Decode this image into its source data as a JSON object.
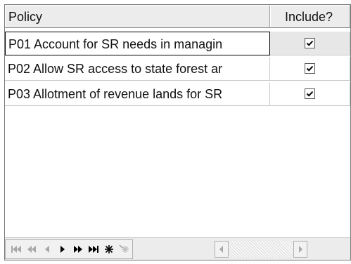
{
  "grid": {
    "columns": {
      "policy": "Policy",
      "include": "Include?"
    },
    "rows": [
      {
        "policy": "P01 Account for SR needs in managin",
        "include": true
      },
      {
        "policy": "P02 Allow SR access to state forest ar",
        "include": true
      },
      {
        "policy": "P03 Allotment of revenue lands for SR",
        "include": true
      }
    ]
  },
  "navigator": {
    "buttons": [
      "first-icon",
      "prior-page-icon",
      "prior-icon",
      "next-icon",
      "next-page-icon",
      "last-icon",
      "new-record-icon",
      "delete-record-icon"
    ]
  },
  "colors": {
    "header_bg": "#ececec",
    "grid_border": "#7a7a7a",
    "selected_bg": "#e7e7e7"
  }
}
